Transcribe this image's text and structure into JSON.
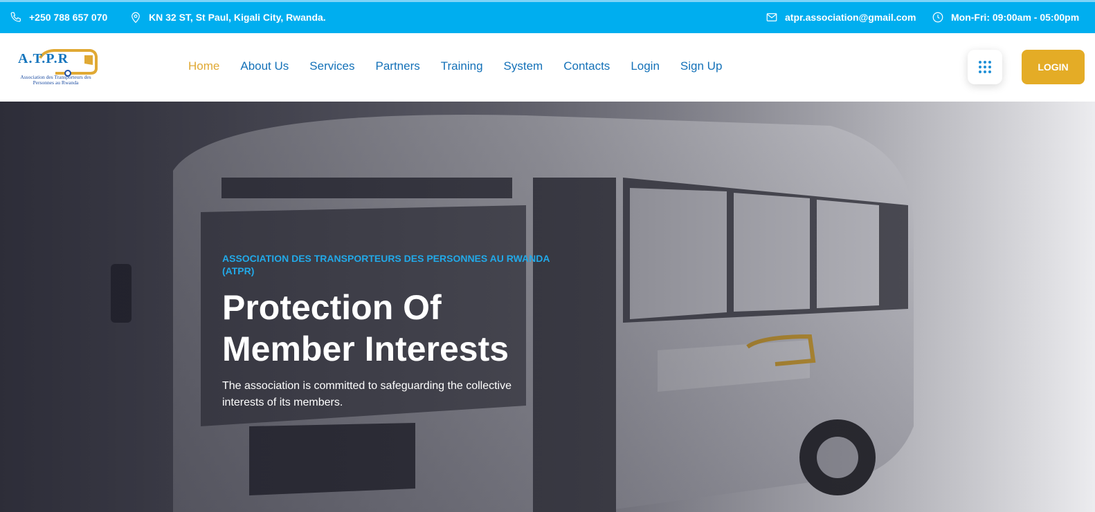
{
  "topbar": {
    "phone": "+250 788 657 070",
    "address": "KN 32 ST, St Paul, Kigali City, Rwanda.",
    "email": "atpr.association@gmail.com",
    "hours": "Mon-Fri: 09:00am - 05:00pm",
    "icons": [
      "phone-icon",
      "map-pin-icon",
      "mail-icon",
      "clock-icon"
    ]
  },
  "logo": {
    "name": "A.T.P.R",
    "tagline": "Association des Transporteurs des Personnes au Rwanda"
  },
  "nav": {
    "items": [
      {
        "label": "Home",
        "active": true
      },
      {
        "label": "About Us"
      },
      {
        "label": "Services"
      },
      {
        "label": "Partners"
      },
      {
        "label": "Training"
      },
      {
        "label": "System"
      },
      {
        "label": "Contacts"
      },
      {
        "label": "Login"
      },
      {
        "label": "Sign Up"
      }
    ],
    "menu_icon": "grid-dots-icon",
    "login_button": "LOGIN"
  },
  "hero": {
    "eyebrow": "ASSOCIATION DES TRANSPORTEURS DES PERSONNES AU RWANDA (ATPR)",
    "headline_line1": "Protection Of",
    "headline_line2": "Member Interests",
    "description": "The association is committed to safeguarding the collective interests of its members."
  },
  "colors": {
    "topbar": "#00aeef",
    "nav_link": "#1471b8",
    "nav_active": "#e0a934",
    "login_button": "#e4ac26",
    "eyebrow": "#22a9e8"
  }
}
